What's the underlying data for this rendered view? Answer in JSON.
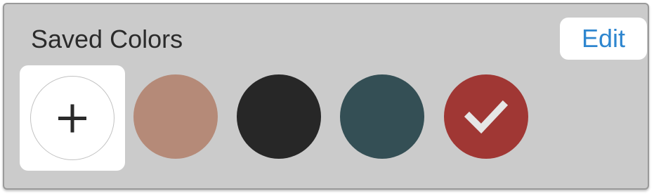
{
  "panel": {
    "title": "Saved Colors",
    "edit_label": "Edit",
    "add_icon": "plus-icon",
    "selected_icon": "checkmark-icon"
  },
  "swatches": [
    {
      "color": "#b58a78",
      "selected": false
    },
    {
      "color": "#272727",
      "selected": false
    },
    {
      "color": "#344f55",
      "selected": false
    },
    {
      "color": "#a03734",
      "selected": true
    }
  ],
  "colors": {
    "panel_bg": "#cbcbcb",
    "edit_text": "#2e86cf",
    "check": "#e6e6e6"
  }
}
